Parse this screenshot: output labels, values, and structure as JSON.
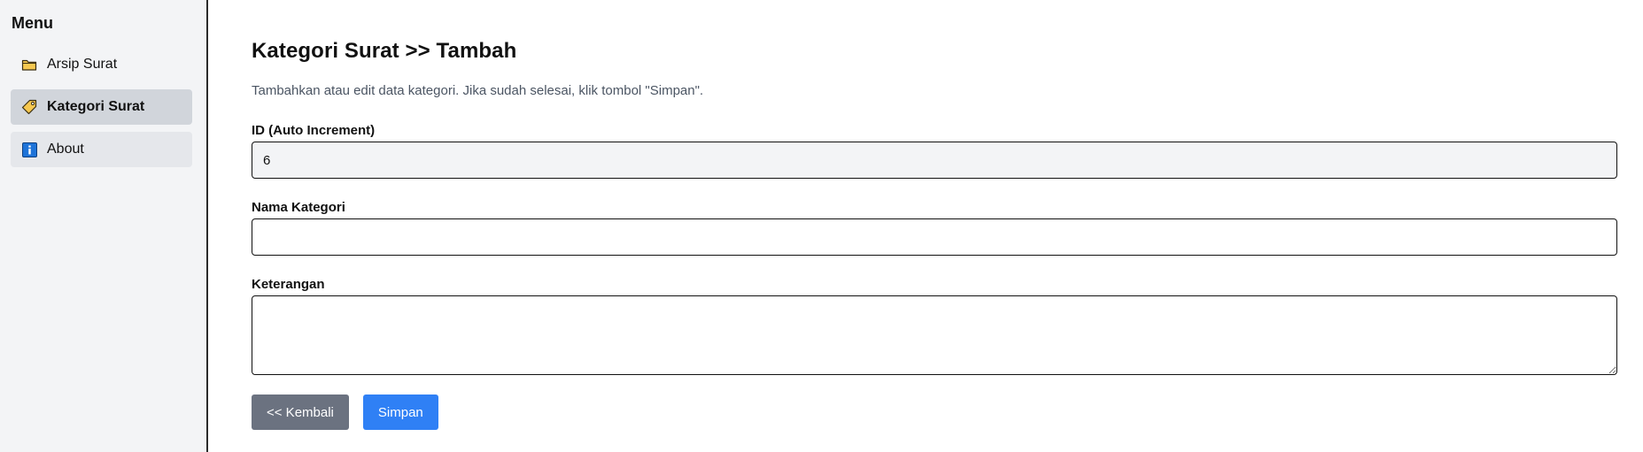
{
  "sidebar": {
    "title": "Menu",
    "items": [
      {
        "label": "Arsip Surat",
        "icon": "folder-icon",
        "active": false
      },
      {
        "label": "Kategori Surat",
        "icon": "tag-icon",
        "active": true
      },
      {
        "label": "About",
        "icon": "info-icon",
        "active": false
      }
    ]
  },
  "main": {
    "title": "Kategori Surat >> Tambah",
    "description": "Tambahkan atau edit data kategori. Jika sudah selesai, klik tombol \"Simpan\".",
    "fields": {
      "id": {
        "label": "ID (Auto Increment)",
        "value": "6"
      },
      "nama": {
        "label": "Nama Kategori",
        "value": ""
      },
      "keterangan": {
        "label": "Keterangan",
        "value": ""
      }
    },
    "buttons": {
      "back": "<< Kembali",
      "save": "Simpan"
    }
  },
  "colors": {
    "sidebar_bg": "#f3f4f6",
    "active_item_bg": "#d1d5db",
    "back_button": "#6b7280",
    "save_button": "#2f80f5"
  }
}
